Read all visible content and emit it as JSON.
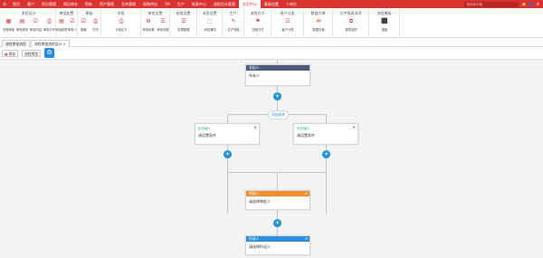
{
  "colors": {
    "brand": "#d9322f",
    "plus": "#1c8fd6",
    "start_header": "#4b5b7c",
    "approver_header": "#f08e2b",
    "cc_header": "#2d8ee0",
    "condition_title": "#1fa87a"
  },
  "topbar": {
    "logo": "⌂",
    "nav": [
      "首页",
      "客户",
      "积分管理",
      "知识库存",
      "财务",
      "资产管理",
      "仓库管理",
      "采购供应",
      "OA",
      "生产",
      "报表中心",
      "流程设计管理",
      "应用中心",
      "基础设置",
      "十单位"
    ],
    "search_placeholder": "知识库中搜",
    "icons": [
      "bell-icon",
      "user-icon",
      "menu-icon"
    ]
  },
  "ribbon": {
    "groups": [
      {
        "title": "流程设计",
        "tools": [
          "流程审批",
          "审批规则",
          "审批内容",
          "审批打印"
        ]
      },
      {
        "title": "审批配置",
        "tools": [
          "审批权限",
          "审批人"
        ]
      },
      {
        "title": "模板",
        "tools": [
          "模板",
          "打印"
        ]
      },
      {
        "title": "字段",
        "tools": [
          "字段定义"
        ]
      },
      {
        "title": "审批设置",
        "tools": [
          "审批设置",
          "审批流程"
        ]
      },
      {
        "title": "权限设置",
        "tools": [
          "权限配置"
        ]
      },
      {
        "title": "消息设置",
        "tools": [
          "消息通知"
        ]
      },
      {
        "title": "生产",
        "tools": [
          "生产流程"
        ]
      },
      {
        "title": "流程方式",
        "tools": [
          "流程方式"
        ]
      },
      {
        "title": "客户分类",
        "tools": [
          "客户分类"
        ]
      },
      {
        "title": "数据字典",
        "tools": [
          "数据字典"
        ]
      },
      {
        "title": "文件报表选项",
        "tools": [
          "报表选项"
        ]
      },
      {
        "title": "流程模板",
        "tools": [
          "模板"
        ]
      }
    ]
  },
  "tabs": [
    {
      "label": "流程审批流程"
    },
    {
      "label": "流程审批流程设计"
    }
  ],
  "toolbar": {
    "save": "保存",
    "preview": "流程预览",
    "round_icon": "⚙"
  },
  "flow": {
    "start": {
      "title": "发起人",
      "body": "所有人"
    },
    "branch_label": "添加条件",
    "conditions": [
      {
        "title": "优先级1",
        "body": "请设置条件"
      },
      {
        "title": "优先级2",
        "body": "请设置条件"
      }
    ],
    "approver": {
      "title": "审批人",
      "body": "请选择审批人"
    },
    "cc": {
      "title": "抄送人",
      "body": "请选择抄送人"
    },
    "plus_symbol": "+",
    "close_symbol": "✕"
  }
}
